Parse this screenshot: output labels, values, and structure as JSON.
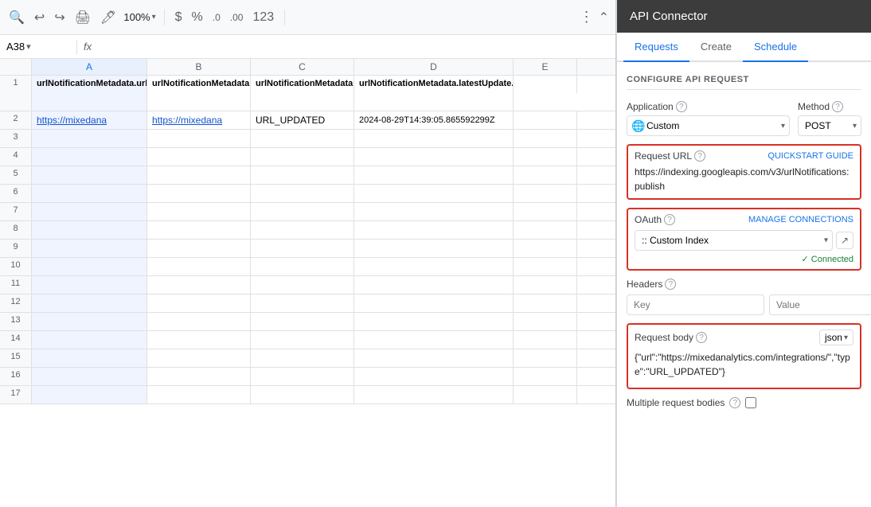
{
  "toolbar": {
    "zoom": "100%",
    "currency_icon": "$",
    "percent_icon": "%",
    "decimal_icon": ".0",
    "decimal2_icon": ".00",
    "number_icon": "123",
    "more_icon": "⋮",
    "collapse_icon": "⌃"
  },
  "formula_bar": {
    "cell_ref": "A38",
    "fx_label": "fx"
  },
  "columns": {
    "headers": [
      "A",
      "B",
      "C",
      "D",
      "E"
    ],
    "row_header": "",
    "col_a_label": "A",
    "col_b_label": "B",
    "col_c_label": "C",
    "col_d_label": "D",
    "col_e_label": "E"
  },
  "rows": [
    {
      "num": "1",
      "a": "urlNotificationMetadata.url",
      "b": "urlNotificationMetadata.latestUpdate.url",
      "c": "urlNotificationMetadata.latestUpdate.type",
      "d": "urlNotificationMetadata.latestUpdate.notifyTime",
      "e": ""
    },
    {
      "num": "2",
      "a": "https://mixedana",
      "b": "https://mixedana",
      "c": "URL_UPDATED",
      "d": "2024-08-29T14:39:05.865592299Z",
      "e": ""
    },
    {
      "num": "3",
      "a": "",
      "b": "",
      "c": "",
      "d": "",
      "e": ""
    },
    {
      "num": "4",
      "a": "",
      "b": "",
      "c": "",
      "d": "",
      "e": ""
    },
    {
      "num": "5",
      "a": "",
      "b": "",
      "c": "",
      "d": "",
      "e": ""
    },
    {
      "num": "6",
      "a": "",
      "b": "",
      "c": "",
      "d": "",
      "e": ""
    },
    {
      "num": "7",
      "a": "",
      "b": "",
      "c": "",
      "d": "",
      "e": ""
    },
    {
      "num": "8",
      "a": "",
      "b": "",
      "c": "",
      "d": "",
      "e": ""
    },
    {
      "num": "9",
      "a": "",
      "b": "",
      "c": "",
      "d": "",
      "e": ""
    },
    {
      "num": "10",
      "a": "",
      "b": "",
      "c": "",
      "d": "",
      "e": ""
    },
    {
      "num": "11",
      "a": "",
      "b": "",
      "c": "",
      "d": "",
      "e": ""
    },
    {
      "num": "12",
      "a": "",
      "b": "",
      "c": "",
      "d": "",
      "e": ""
    },
    {
      "num": "13",
      "a": "",
      "b": "",
      "c": "",
      "d": "",
      "e": ""
    },
    {
      "num": "14",
      "a": "",
      "b": "",
      "c": "",
      "d": "",
      "e": ""
    },
    {
      "num": "15",
      "a": "",
      "b": "",
      "c": "",
      "d": "",
      "e": ""
    },
    {
      "num": "16",
      "a": "",
      "b": "",
      "c": "",
      "d": "",
      "e": ""
    },
    {
      "num": "17",
      "a": "",
      "b": "",
      "c": "",
      "d": "",
      "e": ""
    }
  ],
  "api_panel": {
    "title": "API Connector",
    "tabs": [
      {
        "label": "Requests",
        "active": true
      },
      {
        "label": "Create",
        "active": false
      },
      {
        "label": "Schedule",
        "active": false
      }
    ],
    "section_header": "CONFIGURE API REQUEST",
    "application_label": "Application",
    "application_value": "Custom",
    "method_label": "Method",
    "method_value": "POST",
    "request_url_label": "Request URL",
    "quickstart_label": "QUICKSTART GUIDE",
    "request_url_value": "https://indexing.googleapis.com/v3/urlNotifications:publish",
    "oauth_label": "OAuth",
    "manage_connections_label": "MANAGE CONNECTIONS",
    "oauth_value": ":: Custom Index",
    "connected_label": "✓ Connected",
    "headers_label": "Headers",
    "headers_key_placeholder": "Key",
    "headers_value_placeholder": "Value",
    "request_body_label": "Request body",
    "body_format": "json",
    "body_value": "{\"url\":\"https://mixedanalytics.com/integrations/\",\"type\":\"URL_UPDATED\"}",
    "multiple_request_bodies_label": "Multiple request bodies"
  }
}
